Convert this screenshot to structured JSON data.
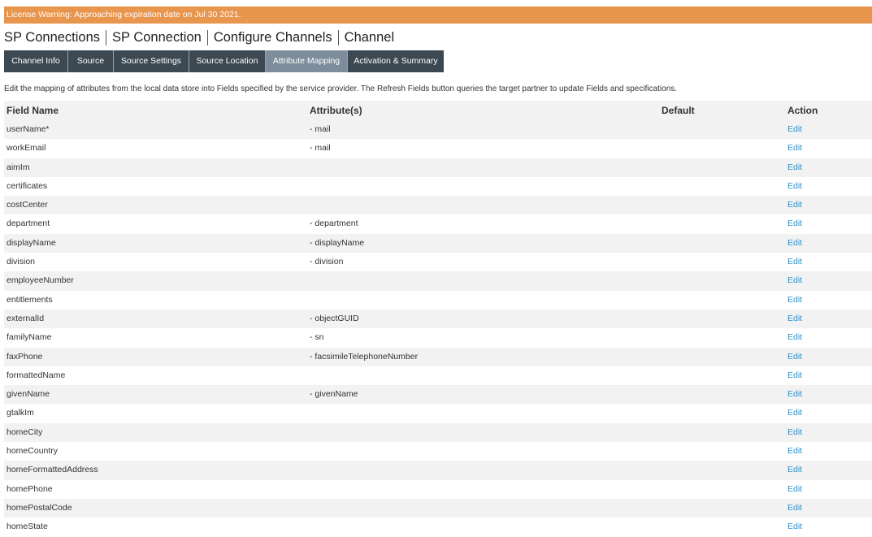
{
  "banner": {
    "text": "License Warning: Approaching expiration date on Jul 30 2021."
  },
  "breadcrumb": [
    "SP Connections",
    "SP Connection",
    "Configure Channels",
    "Channel"
  ],
  "tabs": [
    {
      "label": "Channel Info",
      "active": false
    },
    {
      "label": "Source",
      "active": false
    },
    {
      "label": "Source Settings",
      "active": false
    },
    {
      "label": "Source Location",
      "active": false
    },
    {
      "label": "Attribute Mapping",
      "active": true
    },
    {
      "label": "Activation & Summary",
      "active": false
    }
  ],
  "description": "Edit the mapping of attributes from the local data store into Fields specified by the service provider. The Refresh Fields button queries the target partner to update Fields and specifications.",
  "table": {
    "headers": {
      "field": "Field Name",
      "attributes": "Attribute(s)",
      "default": "Default",
      "action": "Action"
    },
    "rows": [
      {
        "field": "userName*",
        "attr": "- mail",
        "default": "",
        "action": "Edit"
      },
      {
        "field": "workEmail",
        "attr": "- mail",
        "default": "",
        "action": "Edit"
      },
      {
        "field": "aimIm",
        "attr": "",
        "default": "",
        "action": "Edit"
      },
      {
        "field": "certificates",
        "attr": "",
        "default": "",
        "action": "Edit"
      },
      {
        "field": "costCenter",
        "attr": "",
        "default": "",
        "action": "Edit"
      },
      {
        "field": "department",
        "attr": "- department",
        "default": "",
        "action": "Edit"
      },
      {
        "field": "displayName",
        "attr": "- displayName",
        "default": "",
        "action": "Edit"
      },
      {
        "field": "division",
        "attr": "- division",
        "default": "",
        "action": "Edit"
      },
      {
        "field": "employeeNumber",
        "attr": "",
        "default": "",
        "action": "Edit"
      },
      {
        "field": "entitlements",
        "attr": "",
        "default": "",
        "action": "Edit"
      },
      {
        "field": "externalId",
        "attr": "- objectGUID",
        "default": "",
        "action": "Edit"
      },
      {
        "field": "familyName",
        "attr": "- sn",
        "default": "",
        "action": "Edit"
      },
      {
        "field": "faxPhone",
        "attr": "- facsimileTelephoneNumber",
        "default": "",
        "action": "Edit"
      },
      {
        "field": "formattedName",
        "attr": "",
        "default": "",
        "action": "Edit"
      },
      {
        "field": "givenName",
        "attr": "- givenName",
        "default": "",
        "action": "Edit"
      },
      {
        "field": "gtalkIm",
        "attr": "",
        "default": "",
        "action": "Edit"
      },
      {
        "field": "homeCity",
        "attr": "",
        "default": "",
        "action": "Edit"
      },
      {
        "field": "homeCountry",
        "attr": "",
        "default": "",
        "action": "Edit"
      },
      {
        "field": "homeFormattedAddress",
        "attr": "",
        "default": "",
        "action": "Edit"
      },
      {
        "field": "homePhone",
        "attr": "",
        "default": "",
        "action": "Edit"
      },
      {
        "field": "homePostalCode",
        "attr": "",
        "default": "",
        "action": "Edit"
      },
      {
        "field": "homeState",
        "attr": "",
        "default": "",
        "action": "Edit"
      }
    ]
  }
}
